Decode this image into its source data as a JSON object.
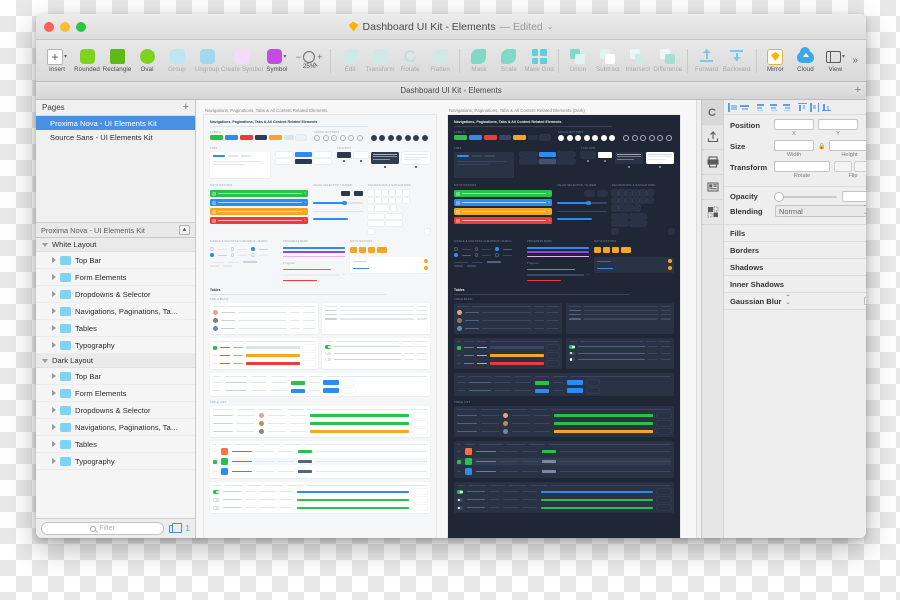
{
  "window": {
    "title": "Dashboard UI Kit - Elements",
    "edited_label": "— Edited",
    "chevron": "⌄",
    "traffic_lights": [
      "close",
      "minimize",
      "maximize"
    ]
  },
  "toolbar": {
    "items": [
      {
        "label": "Insert",
        "icon": "plus-box-icon",
        "enabled": true
      },
      {
        "label": "Rounded",
        "icon": "rounded-rect-icon",
        "enabled": true
      },
      {
        "label": "Rectangle",
        "icon": "rectangle-icon",
        "enabled": true
      },
      {
        "label": "Oval",
        "icon": "oval-icon",
        "enabled": true
      },
      {
        "label": "Group",
        "icon": "group-icon",
        "enabled": false
      },
      {
        "label": "Ungroup",
        "icon": "ungroup-icon",
        "enabled": false
      },
      {
        "label": "Create Symbol",
        "icon": "create-symbol-icon",
        "enabled": false
      },
      {
        "label": "Symbol",
        "icon": "symbol-icon",
        "enabled": true
      },
      {
        "label": "Edit",
        "icon": "edit-icon",
        "enabled": false
      },
      {
        "label": "Transform",
        "icon": "transform-icon",
        "enabled": false
      },
      {
        "label": "Rotate",
        "icon": "rotate-icon",
        "enabled": false
      },
      {
        "label": "Flatten",
        "icon": "flatten-icon",
        "enabled": false
      },
      {
        "label": "Mask",
        "icon": "mask-icon",
        "enabled": false
      },
      {
        "label": "Scale",
        "icon": "scale-icon",
        "enabled": false
      },
      {
        "label": "Make Grid",
        "icon": "make-grid-icon",
        "enabled": false
      },
      {
        "label": "Union",
        "icon": "union-icon",
        "enabled": false
      },
      {
        "label": "Subtract",
        "icon": "subtract-icon",
        "enabled": false
      },
      {
        "label": "Intersect",
        "icon": "intersect-icon",
        "enabled": false
      },
      {
        "label": "Difference",
        "icon": "difference-icon",
        "enabled": false
      },
      {
        "label": "Forward",
        "icon": "forward-icon",
        "enabled": false
      },
      {
        "label": "Backward",
        "icon": "backward-icon",
        "enabled": false
      },
      {
        "label": "Mirror",
        "icon": "mirror-icon",
        "enabled": true
      },
      {
        "label": "Cloud",
        "icon": "cloud-icon",
        "enabled": true
      },
      {
        "label": "View",
        "icon": "view-icon",
        "enabled": true
      }
    ],
    "zoom": {
      "minus": "−",
      "plus": "+",
      "value": "25%",
      "icon": "magnifier-icon"
    },
    "overflow": "»"
  },
  "tabstrip": {
    "tab_name": "Dashboard UI Kit - Elements",
    "add": "+"
  },
  "sidebar": {
    "pages_header": {
      "label": "Pages",
      "add": "+"
    },
    "pages": [
      {
        "label": "Proxima Nova - UI Elements Kit",
        "selected": true
      },
      {
        "label": "Source Sans - UI Elements Kit",
        "selected": false
      }
    ],
    "page_footer": {
      "label": "Proxima Nova - UI Elements Kit",
      "button": "▲"
    },
    "layer_groups": [
      {
        "label": "White Layout",
        "expanded": true,
        "layers": [
          "Top Bar",
          "Form Elements",
          "Dropdowns & Selector",
          "Navigations, Paginations, Ta…",
          "Tables",
          "Typography"
        ]
      },
      {
        "label": "Dark Layout",
        "expanded": true,
        "layers": [
          "Top Bar",
          "Form Elements",
          "Dropdowns & Selector",
          "Navigations, Paginations, Ta…",
          "Tables",
          "Typography"
        ]
      }
    ],
    "filter": {
      "placeholder": "Filter",
      "icon": "search-icon"
    },
    "filter_actions": {
      "duplicate_icon": "duplicate-icon",
      "count": "1"
    }
  },
  "canvas": {
    "artboards": [
      {
        "name": "Navigations, Paginations, Tabs & All Content Related Elements",
        "theme": "light",
        "heading": "Navigations, Paginations, Tabs & All Content Related Elements",
        "sections": [
          "LABELS",
          "SOCIAL BUTTONS",
          "TABS",
          "TOOLTIPS",
          "NOTIFICATIONS",
          "VALUE SELECTOR / SLIDER",
          "PAGINATIONS & NAVIGATIONS",
          "SINGLE & MULTIPLE CHECKBOX / RADIO",
          "PROGRESS BARS",
          "NOTIFICATIONS",
          "Tables"
        ],
        "alert_colors": [
          "#27c24c",
          "#2d8cf0",
          "#f5a623",
          "#ed3b3b"
        ]
      },
      {
        "name": "Navigations, Paginations, Tabs & All Content Related Elements (Dark)",
        "theme": "dark",
        "heading": "Navigations, Paginations, Tabs & All Content Related Elements",
        "sections": [
          "LABELS",
          "SOCIAL BUTTONS",
          "TABS",
          "TOOLTIPS",
          "NOTIFICATIONS",
          "VALUE SELECTOR / SLIDER",
          "PAGINATIONS & NAVIGATIONS",
          "SINGLE & MULTIPLE CHECKBOX / RADIO",
          "PROGRESS BARS",
          "NOTIFICATIONS",
          "Tables"
        ],
        "alert_colors": [
          "#27c24c",
          "#2d8cf0",
          "#f5a623",
          "#ed3b3b"
        ]
      }
    ]
  },
  "inspector": {
    "rail": [
      {
        "icon": "sketch-cloud-icon",
        "selected": true
      },
      {
        "icon": "export-icon",
        "selected": false
      },
      {
        "icon": "print-icon",
        "selected": false
      },
      {
        "icon": "layout-icon",
        "selected": false
      },
      {
        "icon": "grid-icon",
        "selected": false
      }
    ],
    "align_icons": [
      "align-left-icon",
      "align-center-horizontal-icon",
      "align-right-icon",
      "align-top-icon",
      "align-middle-icon",
      "align-bottom-icon",
      "distribute-horizontal-icon",
      "distribute-vertical-icon",
      "distribute-icon"
    ],
    "fields": {
      "position_label": "Position",
      "position_x_caption": "X",
      "position_y_caption": "Y",
      "position_x_value": "",
      "position_y_value": "",
      "size_label": "Size",
      "size_w_caption": "Width",
      "size_h_caption": "Height",
      "size_w_value": "",
      "size_h_value": "",
      "lock_icon": "lock-icon",
      "transform_label": "Transform",
      "rotate_caption": "Rotate",
      "flip_caption": "Flip",
      "rotate_value": "",
      "opacity_label": "Opacity",
      "opacity_value": "",
      "blending_label": "Blending",
      "blending_value": "Normal"
    },
    "properties": [
      {
        "label": "Fills",
        "control": "plus"
      },
      {
        "label": "Borders",
        "control": "plus"
      },
      {
        "label": "Shadows",
        "control": "plus"
      },
      {
        "label": "Inner Shadows",
        "control": "plus"
      },
      {
        "label": "Gaussian Blur",
        "control": "checkbox",
        "stepper": "⌃⌄"
      }
    ]
  },
  "colors": {
    "accent_blue": "#4a90e2",
    "green": "#7ed321",
    "purple": "#c44ce0",
    "orange": "#fdb300",
    "dark_artboard": "#1f2635"
  }
}
